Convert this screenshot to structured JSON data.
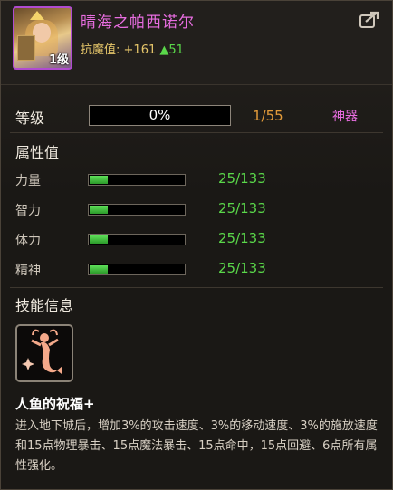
{
  "header": {
    "title": "晴海之帕西诺尔",
    "level_badge": "1级",
    "resist_label": "抗魔值:",
    "resist_plus": "+161",
    "resist_up": "▲51",
    "share_icon": "share-icon"
  },
  "level": {
    "label": "等级",
    "percent_text": "0%",
    "percent_value": 0,
    "count": "1/55",
    "rarity": "神器"
  },
  "attributes": {
    "heading": "属性值",
    "items": [
      {
        "name": "力量",
        "value": "25/133",
        "fill": 0.188
      },
      {
        "name": "智力",
        "value": "25/133",
        "fill": 0.188
      },
      {
        "name": "体力",
        "value": "25/133",
        "fill": 0.188
      },
      {
        "name": "精神",
        "value": "25/133",
        "fill": 0.188
      }
    ]
  },
  "skill": {
    "heading": "技能信息",
    "icon": "mermaid-icon",
    "name": "人鱼的祝福+",
    "description": "进入地下城后，增加3%的攻击速度、3%的移动速度、3%的施放速度和15点物理暴击、15点魔法暴击、15点命中，15点回避、6点所有属性强化。"
  },
  "colors": {
    "title": "#e86de0",
    "resist": "#e6c66a",
    "green": "#5ad84a",
    "orange": "#e29b3a"
  }
}
